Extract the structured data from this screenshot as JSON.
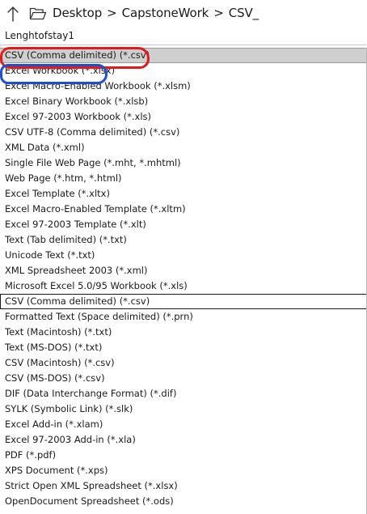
{
  "navigation": {
    "breadcrumb": [
      "Desktop",
      "CapstoneWork",
      "CSV_"
    ],
    "separator": ">"
  },
  "file_name": "Lenghtofstay1",
  "save_as_types": {
    "selected_index": 0,
    "focused_index": 16,
    "items": [
      "CSV (Comma delimited) (*.csv)",
      "Excel Workbook (*.xlsx)",
      "Excel Macro-Enabled Workbook (*.xlsm)",
      "Excel Binary Workbook (*.xlsb)",
      "Excel 97-2003 Workbook (*.xls)",
      "CSV UTF-8 (Comma delimited) (*.csv)",
      "XML Data (*.xml)",
      "Single File Web Page (*.mht, *.mhtml)",
      "Web Page (*.htm, *.html)",
      "Excel Template (*.xltx)",
      "Excel Macro-Enabled Template (*.xltm)",
      "Excel 97-2003 Template (*.xlt)",
      "Text (Tab delimited) (*.txt)",
      "Unicode Text (*.txt)",
      "XML Spreadsheet 2003 (*.xml)",
      "Microsoft Excel 5.0/95 Workbook (*.xls)",
      "CSV (Comma delimited) (*.csv)",
      "Formatted Text (Space delimited) (*.prn)",
      "Text (Macintosh) (*.txt)",
      "Text (MS-DOS) (*.txt)",
      "CSV (Macintosh) (*.csv)",
      "CSV (MS-DOS) (*.csv)",
      "DIF (Data Interchange Format) (*.dif)",
      "SYLK (Symbolic Link) (*.slk)",
      "Excel Add-in (*.xlam)",
      "Excel 97-2003 Add-in (*.xla)",
      "PDF (*.pdf)",
      "XPS Document (*.xps)",
      "Strict Open XML Spreadsheet (*.xlsx)",
      "OpenDocument Spreadsheet (*.ods)"
    ]
  },
  "annotations": {
    "red_oval_color": "#e11b1b",
    "blue_oval_color": "#1f4fd1"
  },
  "icons": {
    "up": "arrow-up-icon",
    "folder": "folder-icon"
  }
}
